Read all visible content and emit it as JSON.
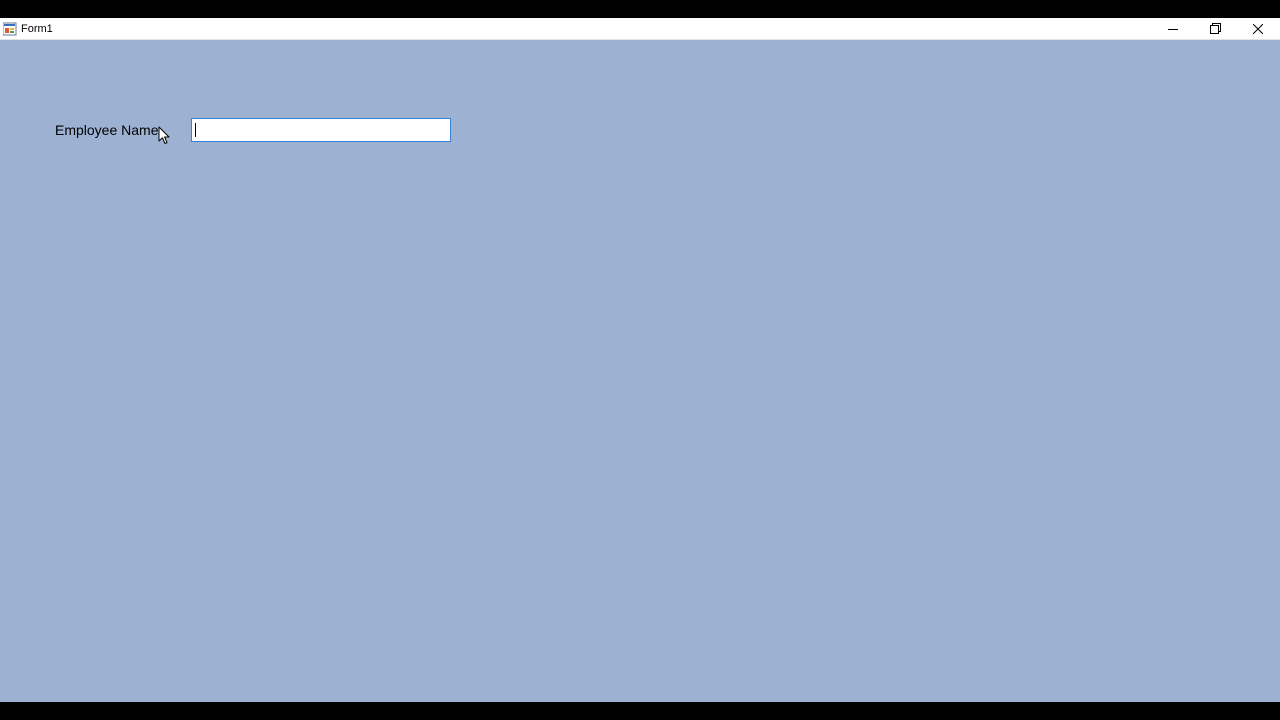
{
  "window": {
    "title": "Form1",
    "background": "#9db2d2",
    "controls": {
      "minimize_icon": "minimize-icon",
      "maximize_icon": "restore-icon",
      "close_icon": "close-icon"
    }
  },
  "form": {
    "employee_name_label": "Employee Name",
    "employee_name_value": "",
    "focus_border_color": "#3c7fd4"
  },
  "cursor": {
    "icon": "mouse-pointer-icon"
  }
}
